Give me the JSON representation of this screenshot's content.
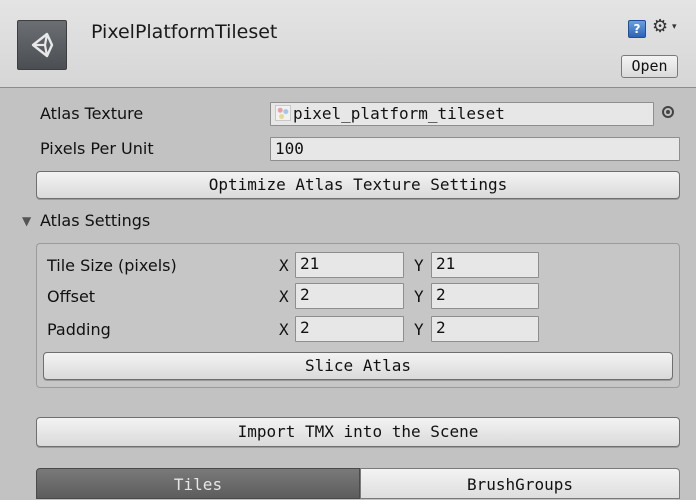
{
  "header": {
    "title": "PixelPlatformTileset",
    "icon": "unity-logo-icon",
    "help_glyph": "?",
    "gear_glyph": "⚙",
    "gear_caret": "▾",
    "open_label": "Open"
  },
  "atlas": {
    "texture_label": "Atlas Texture",
    "texture_value": "pixel_platform_tileset",
    "ppu_label": "Pixels Per Unit",
    "ppu_value": "100",
    "optimize_label": "Optimize Atlas Texture Settings"
  },
  "atlas_settings": {
    "foldout_label": "Atlas Settings",
    "foldout_arrow": "▼",
    "x_label": "X",
    "y_label": "Y",
    "rows": [
      {
        "label": "Tile Size (pixels)",
        "x": "21",
        "y": "21"
      },
      {
        "label": "Offset",
        "x": "2",
        "y": "2"
      },
      {
        "label": "Padding",
        "x": "2",
        "y": "2"
      }
    ],
    "slice_label": "Slice Atlas"
  },
  "import_label": "Import TMX into the Scene",
  "tabs": [
    {
      "label": "Tiles",
      "active": true
    },
    {
      "label": "BrushGroups",
      "active": false
    }
  ],
  "colors": {
    "panel_bg": "#c2c2c2",
    "header_bg": "#d8d8d8",
    "active_tab": "#6a6a6a",
    "help_icon": "#3b78c9"
  }
}
